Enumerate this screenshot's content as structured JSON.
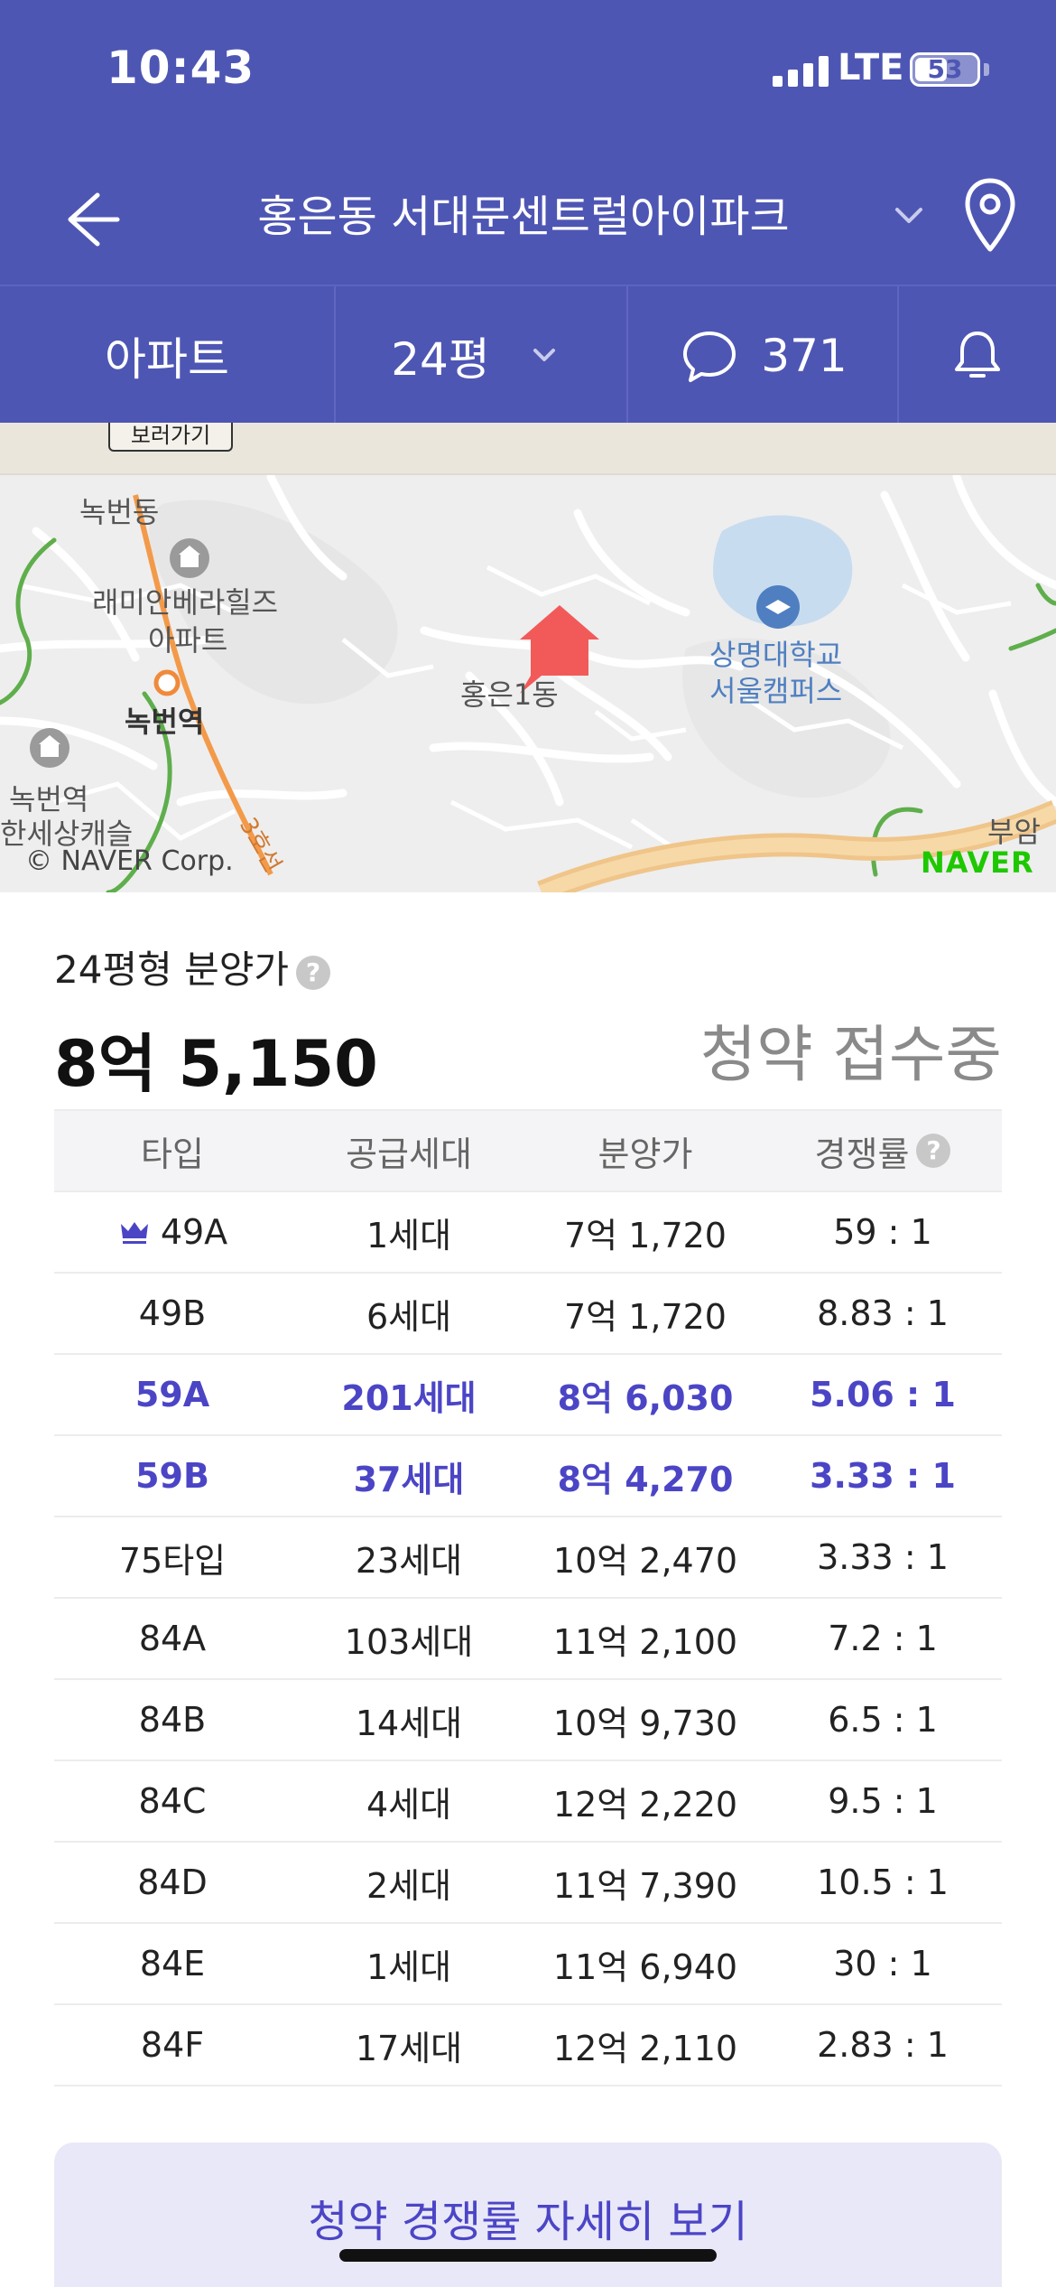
{
  "status_bar": {
    "time": "10:43",
    "network": "LTE",
    "battery": "53",
    "battery_level": 0.53
  },
  "header": {
    "title": "홍은동 서대문센트럴아이파크"
  },
  "tabs": {
    "property_type": "아파트",
    "size": "24평",
    "comment_count": "371"
  },
  "map": {
    "ad_button": "보러가기",
    "labels": {
      "nokbeon_dong": "녹번동",
      "raemian_1": "래미안베라힐즈",
      "raemian_2": "아파트",
      "nokbeon_station": "녹번역",
      "hongeun_1dong": "홍은1동",
      "sangmyung_1": "상명대학교",
      "sangmyung_2": "서울캠퍼스",
      "nokbeon_left_1": "녹번역",
      "nokbeon_left_2": "한세상캐슬",
      "line3": "3호선",
      "buam": "부암"
    },
    "credit": "© NAVER Corp.",
    "brand": "NAVER",
    "marker_color": "#f25a5a"
  },
  "price": {
    "label": "24평형 분양가",
    "help": "?",
    "value": "8억 5,150",
    "status": "청약 접수중"
  },
  "table": {
    "headers": {
      "type": "타입",
      "supply": "공급세대",
      "price": "분양가",
      "rate": "경쟁률",
      "help": "?"
    },
    "rows": [
      {
        "type": "49A",
        "supply": "1세대",
        "price": "7억 1,720",
        "rate": "59 : 1"
      },
      {
        "type": "49B",
        "supply": "6세대",
        "price": "7억 1,720",
        "rate": "8.83 : 1"
      },
      {
        "type": "59A",
        "supply": "201세대",
        "price": "8억 6,030",
        "rate": "5.06 : 1"
      },
      {
        "type": "59B",
        "supply": "37세대",
        "price": "8억 4,270",
        "rate": "3.33 : 1"
      },
      {
        "type": "75타입",
        "supply": "23세대",
        "price": "10억 2,470",
        "rate": "3.33 : 1"
      },
      {
        "type": "84A",
        "supply": "103세대",
        "price": "11억 2,100",
        "rate": "7.2 : 1"
      },
      {
        "type": "84B",
        "supply": "14세대",
        "price": "10억 9,730",
        "rate": "6.5 : 1"
      },
      {
        "type": "84C",
        "supply": "4세대",
        "price": "12억 2,220",
        "rate": "9.5 : 1"
      },
      {
        "type": "84D",
        "supply": "2세대",
        "price": "11억 7,390",
        "rate": "10.5 : 1"
      },
      {
        "type": "84E",
        "supply": "1세대",
        "price": "11억 6,940",
        "rate": "30 : 1"
      },
      {
        "type": "84F",
        "supply": "17세대",
        "price": "12억 2,110",
        "rate": "2.83 : 1"
      }
    ]
  },
  "detail_button": {
    "label": "청약 경쟁률 자세히 보기"
  },
  "colors": {
    "primary": "#4e56b4",
    "highlight": "#4b45c6",
    "status_gray": "#8a8a8a"
  }
}
